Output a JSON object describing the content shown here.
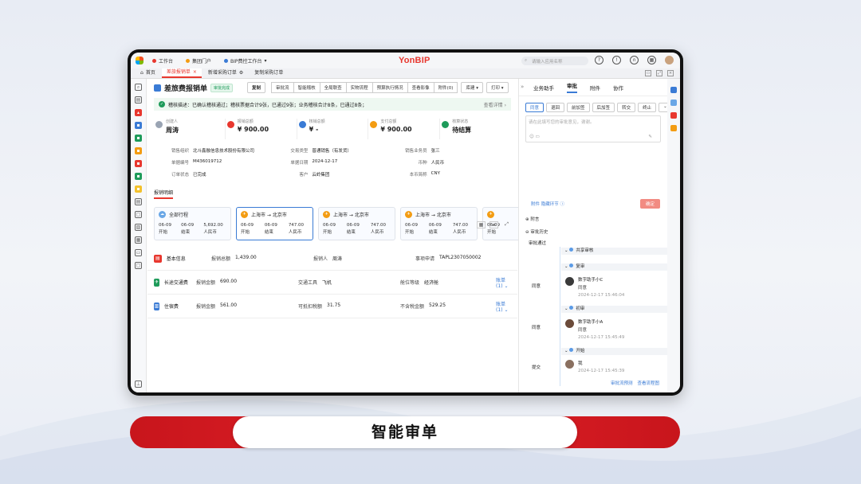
{
  "topbar": {
    "tabs": [
      "工作台",
      "集团门户",
      "BIP费控工作台"
    ],
    "brand": "YonBIP",
    "search_placeholder": "请输入应用名称"
  },
  "pagetabs": [
    {
      "label": "首页"
    },
    {
      "label": "差旅报销单",
      "active": true
    },
    {
      "label": "新增采购订单"
    },
    {
      "label": "复制采购订单"
    }
  ],
  "header": {
    "title": "差旅费报销单",
    "status": "审批完成",
    "buttons": [
      "复制",
      "审批流",
      "智能稽核",
      "全局联查",
      "实物流程",
      "预算执行情况",
      "查看影像",
      "附件(0)",
      "库建",
      "打印"
    ]
  },
  "alert": {
    "text": "稽核描述：已确认稽核通过；稽核票据合计9张，已通过9张；业务稽核合计8条，已通过8条；",
    "more": "查看详情"
  },
  "stats": [
    {
      "label": "创建人",
      "value": "周涛",
      "color": "#9aa4b3"
    },
    {
      "label": "报销总额",
      "value": "¥ 900.00",
      "color": "#e8372e"
    },
    {
      "label": "核销总额",
      "value": "¥ -",
      "color": "#3a7bd5"
    },
    {
      "label": "支付总额",
      "value": "¥ 900.00",
      "color": "#f39c12"
    },
    {
      "label": "核算状态",
      "value": "待结算",
      "color": "#1e9b5a"
    }
  ],
  "fields": [
    {
      "k": "销售组织",
      "v": "北斗鑫融信息技术股份有限公司"
    },
    {
      "k": "交易类型",
      "v": "普通销售（有发货）"
    },
    {
      "k": "销售业务员",
      "v": "张三"
    },
    {
      "k": "单据编号",
      "v": "M436019712"
    },
    {
      "k": "单据日期",
      "v": "2024-12-17"
    },
    {
      "k": "币种",
      "v": "人民币"
    },
    {
      "k": "订单状态",
      "v": "已完成"
    },
    {
      "k": "客户",
      "v": "云岭集团"
    },
    {
      "k": "本币简称",
      "v": "CNY"
    }
  ],
  "section_title": "报销明细",
  "cards": [
    {
      "title": "全部行程",
      "d1": "06-09",
      "d2": "06-09",
      "amt": "5,692.00",
      "l1": "开始",
      "l2": "结束",
      "cur": "人民币"
    },
    {
      "title": "上海市 → 北京市",
      "d1": "06-09",
      "d2": "06-09",
      "amt": "747.00",
      "l1": "开始",
      "l2": "结束",
      "cur": "人民币"
    },
    {
      "title": "上海市 → 北京市",
      "d1": "06-09",
      "d2": "06-09",
      "amt": "747.00",
      "l1": "开始",
      "l2": "结束",
      "cur": "人民币"
    },
    {
      "title": "上海市 → 北京市",
      "d1": "06-09",
      "d2": "06-09",
      "amt": "747.00",
      "l1": "开始",
      "l2": "结束",
      "cur": "人民币"
    },
    {
      "title": "",
      "d1": "06-09",
      "d2": "",
      "amt": "",
      "l1": "开始",
      "l2": "",
      "cur": ""
    }
  ],
  "rows": [
    {
      "title": "基本信息",
      "c": [
        [
          "报销总额",
          "1,439.00"
        ],
        [
          "报销人",
          "周涛"
        ],
        [
          "事项申请",
          "TAPL2307050002"
        ]
      ],
      "link": ""
    },
    {
      "title": "长途交通费",
      "c": [
        [
          "报销金额",
          "690.00"
        ],
        [
          "交通工具",
          "飞机"
        ],
        [
          "舱位等级",
          "经济舱"
        ]
      ],
      "link": "账单(1)"
    },
    {
      "title": "住宿费",
      "c": [
        [
          "报销金额",
          "561.00"
        ],
        [
          "可抵扣税额",
          "31.75"
        ],
        [
          "不含税金额",
          "529.25"
        ]
      ],
      "link": "账单(1)"
    }
  ],
  "right": {
    "tabs": [
      "业务助手",
      "审批",
      "附件",
      "协作"
    ],
    "ops": [
      "同意",
      "退回",
      "前加签",
      "后加签",
      "转交",
      "终止"
    ],
    "comment_placeholder": "请在此填写您的审批意见，谢谢。",
    "attach": "附件 隐藏环节",
    "confirm": "确定",
    "s1": "附言",
    "s2": "审批历史",
    "flow_label": "审批通过",
    "stage1": "共享审核",
    "stage2": "复审",
    "n1_action": "同意",
    "n1_name": "数字助手小C",
    "n1_res": "同意",
    "n1_time": "2024-12-17 15:46:04",
    "stage3": "初审",
    "n2_action": "同意",
    "n2_name": "数字助手小A",
    "n2_res": "同意",
    "n2_time": "2024-12-17 15:45:49",
    "stage4": "开始",
    "n3_action": "提交",
    "n3_name": "我",
    "n3_time": "2024-12-17 15:45:39",
    "foot1": "审批流预测",
    "foot2": "查看流程图"
  },
  "banner": "智能审单"
}
